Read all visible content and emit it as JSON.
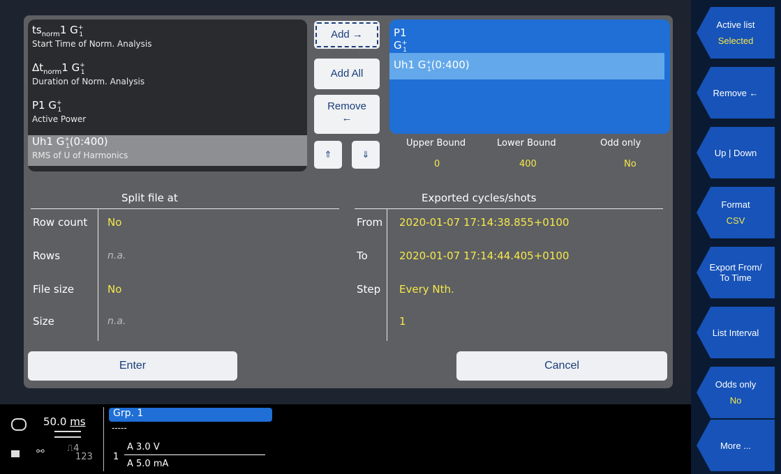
{
  "source_list": [
    {
      "name_main": "ts",
      "name_sub": "norm",
      "name_rest": "1 G",
      "name_sup": "+",
      "name_sub2": "1",
      "desc": "Start Time of Norm. Analysis"
    },
    {
      "name_main": "Δt",
      "name_sub": "norm",
      "name_rest": "1 G",
      "name_sup": "+",
      "name_sub2": "1",
      "desc": "Duration of Norm. Analysis"
    },
    {
      "name_main": "P1 G",
      "name_sub": "",
      "name_rest": "",
      "name_sup": "+",
      "name_sub2": "1",
      "desc": "Active Power"
    },
    {
      "name_main": "Uh1 G",
      "name_sub": "",
      "name_rest": "",
      "name_sup": "+",
      "name_sub2": "1",
      "name_tail": "(0:400)",
      "desc": "RMS of U of Harmonics"
    }
  ],
  "buttons": {
    "add": "Add →",
    "add_all": "Add All",
    "remove_line1": "Remove",
    "remove_line2": "←",
    "up": "⇑",
    "down": "⇓",
    "enter": "Enter",
    "cancel": "Cancel"
  },
  "selected_list": [
    {
      "name": "P1 G",
      "sup": "+",
      "sub": "1",
      "tail": ""
    },
    {
      "name": "Uh1 G",
      "sup": "+",
      "sub": "1",
      "tail": "(0:400)"
    }
  ],
  "bounds": {
    "upper_label": "Upper Bound",
    "upper_val": "0",
    "lower_label": "Lower Bound",
    "lower_val": "400",
    "odd_label": "Odd only",
    "odd_val": "No"
  },
  "split": {
    "title": "Split file at",
    "rows": [
      {
        "label": "Row count",
        "value": "No",
        "na": false
      },
      {
        "label": "Rows",
        "value": "n.a.",
        "na": true
      },
      {
        "label": "File size",
        "value": "No",
        "na": false
      },
      {
        "label": "Size",
        "value": "n.a.",
        "na": true
      }
    ]
  },
  "exported": {
    "title": "Exported cycles/shots",
    "rows": [
      {
        "label": "From",
        "value": "2020-01-07 17:14:38.855+0100"
      },
      {
        "label": "To",
        "value": "2020-01-07 17:14:44.405+0100"
      },
      {
        "label": "Step",
        "value": "Every Nth."
      },
      {
        "label": "",
        "value": "1"
      }
    ]
  },
  "softkeys": [
    {
      "label": "Active list",
      "value": "Selected"
    },
    {
      "label": "Remove ←",
      "value": ""
    },
    {
      "label": "Up | Down",
      "value": ""
    },
    {
      "label": "Format",
      "value": "CSV"
    },
    {
      "label": "Export From/\nTo Time",
      "value": ""
    },
    {
      "label": "List Interval",
      "value": ""
    },
    {
      "label": "Odds only",
      "value": "No"
    },
    {
      "label": "More ...",
      "value": ""
    }
  ],
  "status": {
    "time_val": "50.0",
    "time_unit": "ms",
    "group_label": "Grp. 1",
    "group_sub": "-----",
    "channel_num": "1",
    "ch_a_range": "A 3.0 V",
    "ch_b_range": "A 5.0 mA",
    "usb_digits": "123",
    "usb_sup": "4"
  },
  "colors": {
    "accent": "#1753b8",
    "value_yellow": "#f6e84a",
    "selected_blue": "#1f6fd6"
  }
}
